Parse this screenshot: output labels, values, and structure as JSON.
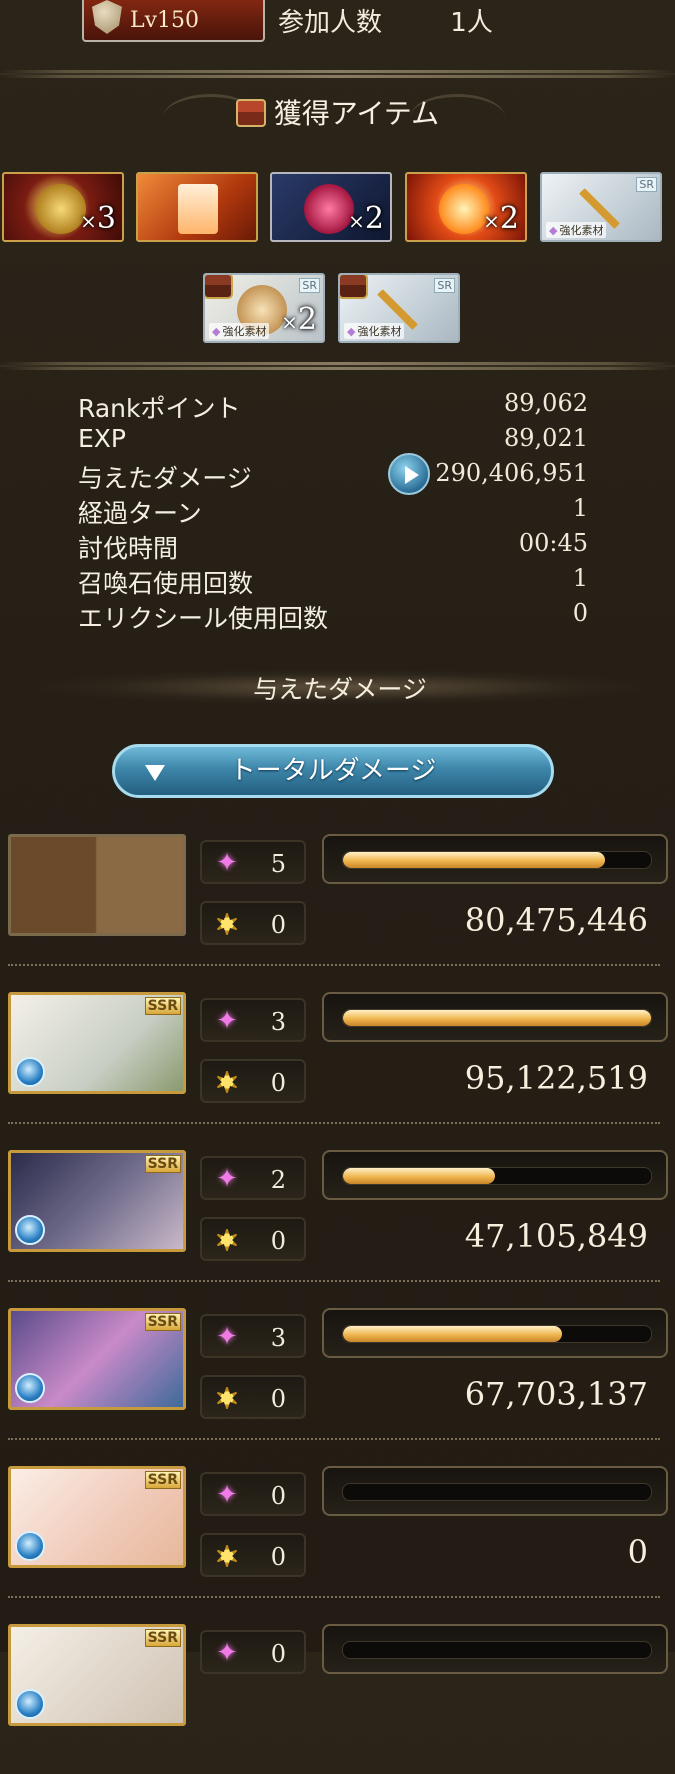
{
  "header": {
    "difficulty_level": "Lv150",
    "participants_label": "参加人数",
    "participants_value": "1人"
  },
  "items_section": {
    "title": "獲得アイテム",
    "items": [
      {
        "count": "3",
        "tag": "",
        "rarity": ""
      },
      {
        "count": "",
        "tag": "",
        "rarity": ""
      },
      {
        "count": "2",
        "tag": "",
        "rarity": ""
      },
      {
        "count": "2",
        "tag": "",
        "rarity": ""
      },
      {
        "count": "",
        "tag": "強化素材",
        "rarity": "SR"
      },
      {
        "count": "2",
        "tag": "強化素材",
        "rarity": "SR"
      },
      {
        "count": "",
        "tag": "強化素材",
        "rarity": "SR"
      }
    ]
  },
  "stats": [
    {
      "label": "Rankポイント",
      "value": "89,062"
    },
    {
      "label": "EXP",
      "value": "89,021"
    },
    {
      "label": "与えたダメージ",
      "value": "290,406,951"
    },
    {
      "label": "経過ターン",
      "value": "1"
    },
    {
      "label": "討伐時間",
      "value": "00:45"
    },
    {
      "label": "召喚石使用回数",
      "value": "1"
    },
    {
      "label": "エリクシール使用回数",
      "value": "0"
    }
  ],
  "damage_section": {
    "title": "与えたダメージ",
    "total_button": "トータルダメージ"
  },
  "characters": [
    {
      "ability": "5",
      "ca": "0",
      "damage": "80,475,446",
      "fill": 0.85,
      "ssr": "",
      "element": ""
    },
    {
      "ability": "3",
      "ca": "0",
      "damage": "95,122,519",
      "fill": 1.0,
      "ssr": "SSR",
      "element": "water"
    },
    {
      "ability": "2",
      "ca": "0",
      "damage": "47,105,849",
      "fill": 0.495,
      "ssr": "SSR",
      "element": "water"
    },
    {
      "ability": "3",
      "ca": "0",
      "damage": "67,703,137",
      "fill": 0.71,
      "ssr": "SSR",
      "element": "water"
    },
    {
      "ability": "0",
      "ca": "0",
      "damage": "0",
      "fill": 0.0,
      "ssr": "SSR",
      "element": "water"
    },
    {
      "ability": "0",
      "ca": "",
      "damage": "",
      "fill": 0.0,
      "ssr": "SSR",
      "element": "water"
    }
  ],
  "colors": {
    "bar_fill": "#f0b64e",
    "accent_blue": "#3d86aa",
    "gold_frame": "#c79a3e"
  }
}
